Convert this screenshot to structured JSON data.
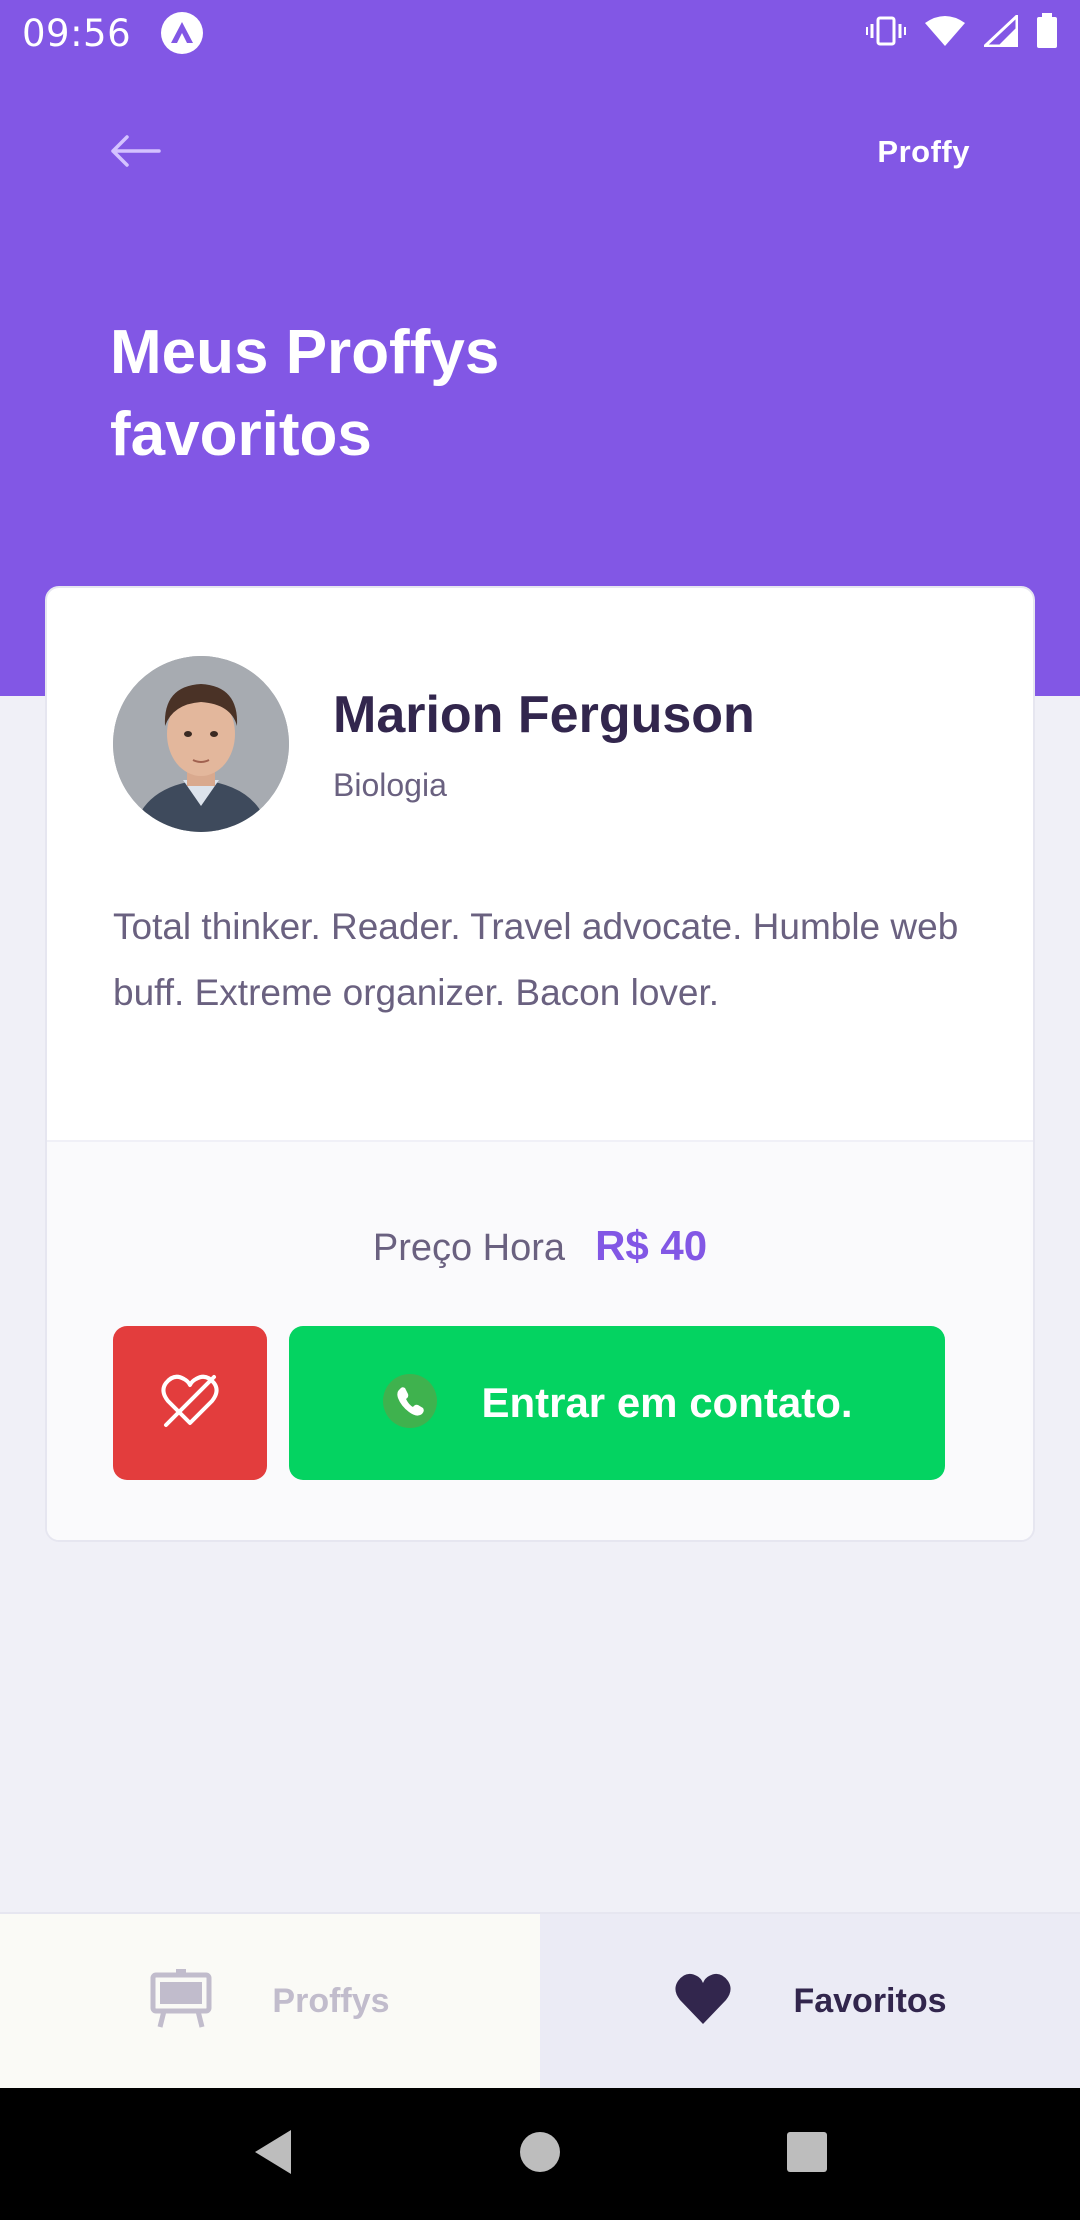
{
  "status_bar": {
    "time": "09:56",
    "icons": [
      "react-native-icon",
      "vibrate-icon",
      "wifi-icon",
      "signal-icon",
      "battery-icon"
    ]
  },
  "header": {
    "brand": "Proffy",
    "title": "Meus Proffys favoritos"
  },
  "teacher": {
    "name": "Marion Ferguson",
    "subject": "Biologia",
    "bio": "Total thinker. Reader. Travel advocate. Humble web buff. Extreme organizer. Bacon lover.",
    "price_label": "Preço Hora",
    "price_value": "R$ 40",
    "contact_label": "Entrar em contato."
  },
  "tabs": [
    {
      "label": "Proffys",
      "icon": "easel-icon",
      "active": false
    },
    {
      "label": "Favoritos",
      "icon": "heart-icon",
      "active": true
    }
  ],
  "colors": {
    "primary": "#8257E5",
    "background": "#F0F0F7",
    "title_text": "#32264D",
    "body_text": "#6A6180",
    "danger": "#E33D3D",
    "whatsapp_green": "#04D361",
    "tab_inactive": "#C1BCCC"
  },
  "system_nav": [
    "back-icon",
    "home-icon",
    "recents-icon"
  ]
}
